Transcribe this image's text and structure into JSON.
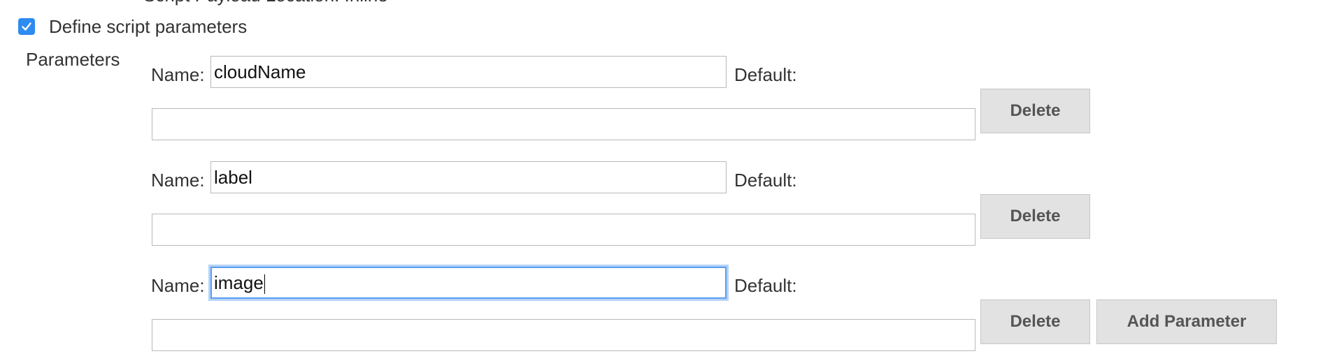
{
  "header": {
    "cut_text": "Script Payload Location: Inline",
    "define_params_checked": true,
    "define_params_label": "Define script parameters",
    "parameters_label": "Parameters"
  },
  "parameters": [
    {
      "name_label": "Name:",
      "name_value": "cloudName",
      "default_label": "Default:",
      "default_value": "",
      "delete_label": "Delete"
    },
    {
      "name_label": "Name:",
      "name_value": "label",
      "default_label": "Default:",
      "default_value": "",
      "delete_label": "Delete"
    },
    {
      "name_label": "Name:",
      "name_value": "image",
      "default_label": "Default:",
      "default_value": "",
      "delete_label": "Delete",
      "focused": true
    }
  ],
  "add_parameter_label": "Add Parameter",
  "colors": {
    "checkbox": "#2d8cf0",
    "focus_ring": "#5b9ef0",
    "button_bg": "#e2e2e2",
    "text": "#333333"
  }
}
